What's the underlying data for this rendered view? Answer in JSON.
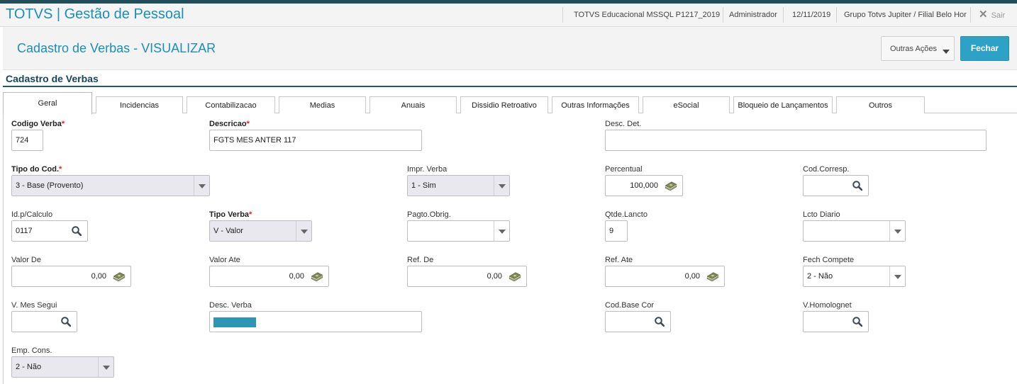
{
  "header": {
    "app_title": "TOTVS | Gestão de Pessoal",
    "environment": "TOTVS Educacional MSSQL P1217_2019",
    "user": "Administrador",
    "date": "12/11/2019",
    "company": "Grupo Totvs Jupiter / Filial Belo Hor",
    "logout_label": "Sair"
  },
  "titlebar": {
    "page_title": "Cadastro de Verbas - VISUALIZAR",
    "other_actions_label": "Outras Ações",
    "close_label": "Fechar"
  },
  "section_title": "Cadastro de Verbas",
  "tabs": [
    {
      "label": "Geral",
      "active": true
    },
    {
      "label": "Incidencias"
    },
    {
      "label": "Contabilizacao"
    },
    {
      "label": "Medias"
    },
    {
      "label": "Anuais"
    },
    {
      "label": "Dissidio Retroativo"
    },
    {
      "label": "Outras Informações"
    },
    {
      "label": "eSocial"
    },
    {
      "label": "Bloqueio de Lançamentos"
    },
    {
      "label": "Outros"
    }
  ],
  "colors": {
    "accent": "#1a8fb8",
    "primary_button": "#2ea2c6",
    "required_marker": "#e02020",
    "header_bar": "#1f4e5a"
  },
  "fields": {
    "codigo_verba": {
      "label": "Codigo Verba",
      "required_mark": "*",
      "value": "724"
    },
    "descricao": {
      "label": "Descricao",
      "required_mark": "*",
      "value": "FGTS MES ANTER 117"
    },
    "desc_det": {
      "label": "Desc. Det.",
      "value": ""
    },
    "tipo_cod": {
      "label": "Tipo do Cod.",
      "required_mark": "*",
      "value": "3 - Base (Provento)"
    },
    "impr_verba": {
      "label": "Impr. Verba",
      "value": "1 - Sim"
    },
    "percentual": {
      "label": "Percentual",
      "value": "100,000"
    },
    "cod_corresp": {
      "label": "Cod.Corresp.",
      "value": ""
    },
    "id_calculo": {
      "label": "Id.p/Calculo",
      "value": "0117"
    },
    "tipo_verba": {
      "label": "Tipo Verba",
      "required_mark": "*",
      "value": "V - Valor"
    },
    "pagto_obrig": {
      "label": "Pagto.Obrig.",
      "value": ""
    },
    "qtde_lancto": {
      "label": "Qtde.Lancto",
      "value": "9"
    },
    "lcto_diario": {
      "label": "Lcto Diario",
      "value": ""
    },
    "valor_de": {
      "label": "Valor De",
      "value": "0,00"
    },
    "valor_ate": {
      "label": "Valor Ate",
      "value": "0,00"
    },
    "ref_de": {
      "label": "Ref. De",
      "value": "0,00"
    },
    "ref_ate": {
      "label": "Ref. Ate",
      "value": "0,00"
    },
    "fech_compete": {
      "label": "Fech Compete",
      "value": "2 - Não"
    },
    "v_mes_segui": {
      "label": "V. Mes Segui",
      "value": ""
    },
    "desc_verba": {
      "label": "Desc. Verba",
      "value": ""
    },
    "cod_base_cor": {
      "label": "Cod.Base Cor",
      "value": ""
    },
    "v_homolognet": {
      "label": "V.Homolognet",
      "value": ""
    },
    "emp_cons": {
      "label": "Emp. Cons.",
      "value": "2 - Não"
    }
  }
}
